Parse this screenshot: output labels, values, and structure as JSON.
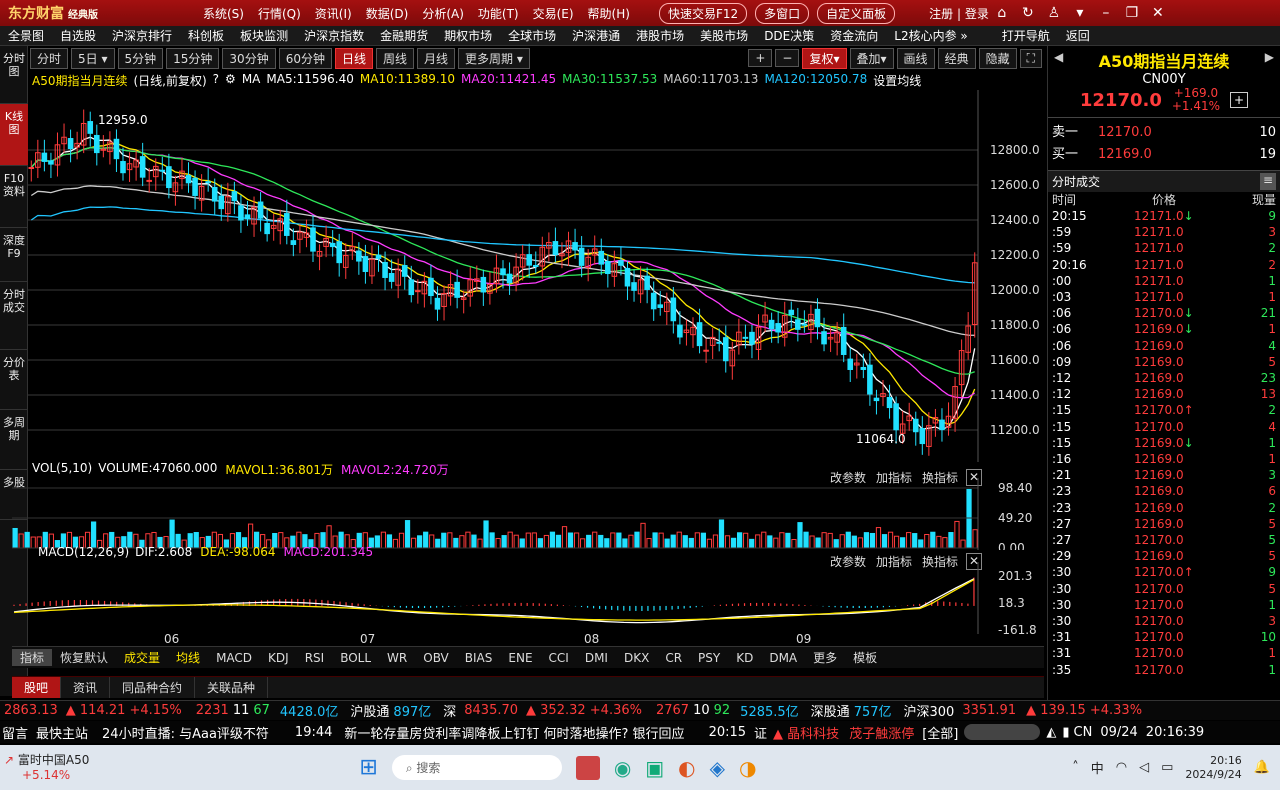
{
  "titlebar": {
    "app_name": "东方财富",
    "edition": "经典版",
    "menus": [
      "系统(S)",
      "行情(Q)",
      "资讯(I)",
      "数据(D)",
      "分析(A)",
      "功能(T)",
      "交易(E)",
      "帮助(H)"
    ],
    "quick_trade": "快速交易F12",
    "multi_window": "多窗口",
    "custom_panel": "自定义面板",
    "register_login": "注册 | 登录"
  },
  "navbar": {
    "items": [
      "全景图",
      "自选股",
      "沪深京排行",
      "科创板",
      "板块监测",
      "沪深京指数",
      "金融期货",
      "期权市场",
      "全球市场",
      "沪深港通",
      "港股市场",
      "美股市场",
      "DDE决策",
      "资金流向",
      "L2核心内参 »",
      "打开导航",
      "返回"
    ]
  },
  "left_tabs": [
    "分时图",
    "K线图",
    "F10资料",
    "深度F9",
    "分时成交",
    "分价表",
    "多周期",
    "多股"
  ],
  "period_bar": {
    "buttons": [
      "分时",
      "5日",
      "5分钟",
      "15分钟",
      "30分钟",
      "60分钟",
      "日线",
      "周线",
      "月线",
      "更多周期"
    ],
    "active": "日线",
    "right_buttons": [
      "复权",
      "叠加",
      "画线",
      "经典",
      "隐藏"
    ]
  },
  "ma_line": {
    "name": "A50期指当月连续",
    "mode": "(日线,前复权)",
    "ma_label": "MA",
    "ma5": "MA5:11596.40",
    "ma10": "MA10:11389.10",
    "ma20": "MA20:11421.45",
    "ma30": "MA30:11537.53",
    "ma60": "MA60:11703.13",
    "ma120": "MA120:12050.78",
    "set_ma": "设置均线"
  },
  "price_chart": {
    "y_ticks": [
      "12800.0",
      "12600.0",
      "12400.0",
      "12200.0",
      "12000.0",
      "11800.0",
      "11600.0",
      "11400.0",
      "11200.0"
    ],
    "high_label": "12959.0",
    "low_label": "11064.0",
    "x_labels": [
      "06",
      "07",
      "08",
      "09"
    ]
  },
  "volume_panel": {
    "title": "VOL(5,10)",
    "volume": "VOLUME:47060.000",
    "mavol1": "MAVOL1:36.801万",
    "mavol2": "MAVOL2:24.720万",
    "y_ticks": [
      "98.40",
      "49.20",
      "0.00"
    ],
    "actions": [
      "改参数",
      "加指标",
      "换指标"
    ]
  },
  "macd_panel": {
    "title": "MACD(12,26,9)",
    "dif": "DIF:2.608",
    "dea": "DEA:-98.064",
    "macd": "MACD:201.345",
    "y_ticks": [
      "201.3",
      "18.3",
      "-161.8"
    ],
    "actions": [
      "改参数",
      "加指标",
      "换指标"
    ]
  },
  "indicator_tabs": [
    "指标",
    "恢复默认",
    "成交量",
    "均线",
    "MACD",
    "KDJ",
    "RSI",
    "BOLL",
    "WR",
    "OBV",
    "BIAS",
    "ENE",
    "CCI",
    "DMI",
    "DKX",
    "CR",
    "PSY",
    "KD",
    "DMA",
    "更多",
    "模板"
  ],
  "bottom_tabs": [
    "股吧",
    "资讯",
    "同品种合约",
    "关联品种"
  ],
  "right_panel": {
    "name": "A50期指当月连续",
    "code": "CN00Y",
    "price": "12170.0",
    "change": "+169.0",
    "change_pct": "+1.41%",
    "sell1_label": "卖一",
    "sell1_price": "12170.0",
    "sell1_vol": "10",
    "buy1_label": "买一",
    "buy1_price": "12169.0",
    "buy1_vol": "19",
    "trades_title": "分时成交",
    "headers": [
      "时间",
      "价格",
      "现量"
    ],
    "trades": [
      {
        "t": "20:15",
        "p": "12171.0",
        "a": "↓",
        "v": "9"
      },
      {
        "t": ":59",
        "p": "12171.0",
        "a": "",
        "v": "3"
      },
      {
        "t": ":59",
        "p": "12171.0",
        "a": "",
        "v": "2"
      },
      {
        "t": "20:16",
        "p": "12171.0",
        "a": "",
        "v": "2"
      },
      {
        "t": ":00",
        "p": "12171.0",
        "a": "",
        "v": "1"
      },
      {
        "t": ":03",
        "p": "12171.0",
        "a": "",
        "v": "1"
      },
      {
        "t": ":06",
        "p": "12170.0",
        "a": "↓",
        "v": "21"
      },
      {
        "t": ":06",
        "p": "12169.0",
        "a": "↓",
        "v": "1"
      },
      {
        "t": ":06",
        "p": "12169.0",
        "a": "",
        "v": "4"
      },
      {
        "t": ":09",
        "p": "12169.0",
        "a": "",
        "v": "5"
      },
      {
        "t": ":12",
        "p": "12169.0",
        "a": "",
        "v": "23"
      },
      {
        "t": ":12",
        "p": "12169.0",
        "a": "",
        "v": "13"
      },
      {
        "t": ":15",
        "p": "12170.0",
        "a": "↑",
        "v": "2"
      },
      {
        "t": ":15",
        "p": "12170.0",
        "a": "",
        "v": "4"
      },
      {
        "t": ":15",
        "p": "12169.0",
        "a": "↓",
        "v": "1"
      },
      {
        "t": ":16",
        "p": "12169.0",
        "a": "",
        "v": "1"
      },
      {
        "t": ":21",
        "p": "12169.0",
        "a": "",
        "v": "3"
      },
      {
        "t": ":23",
        "p": "12169.0",
        "a": "",
        "v": "6"
      },
      {
        "t": ":23",
        "p": "12169.0",
        "a": "",
        "v": "2"
      },
      {
        "t": ":27",
        "p": "12169.0",
        "a": "",
        "v": "5"
      },
      {
        "t": ":27",
        "p": "12170.0",
        "a": "",
        "v": "5"
      },
      {
        "t": ":29",
        "p": "12169.0",
        "a": "",
        "v": "5"
      },
      {
        "t": ":30",
        "p": "12170.0",
        "a": "↑",
        "v": "9"
      },
      {
        "t": ":30",
        "p": "12170.0",
        "a": "",
        "v": "5"
      },
      {
        "t": ":30",
        "p": "12170.0",
        "a": "",
        "v": "1"
      },
      {
        "t": ":30",
        "p": "12170.0",
        "a": "",
        "v": "3"
      },
      {
        "t": ":31",
        "p": "12170.0",
        "a": "",
        "v": "10"
      },
      {
        "t": ":31",
        "p": "12170.0",
        "a": "",
        "v": "1"
      },
      {
        "t": ":35",
        "p": "12170.0",
        "a": "",
        "v": "1"
      }
    ]
  },
  "ticker": {
    "sh_index": "2863.13",
    "sh_change": "▲ 114.21 +4.15%",
    "sh_up": "2231",
    "sh_flat": "11",
    "sh_down": "67",
    "sh_amount": "4428.0亿",
    "hgt_label": "沪股通",
    "hgt_value": "897亿",
    "sz_label": "深",
    "sz_index": "8435.70",
    "sz_change": "▲ 352.32 +4.36%",
    "sz_up": "2767",
    "sz_flat": "10",
    "sz_down": "92",
    "sz_amount": "5285.5亿",
    "sgt_label": "深股通",
    "sgt_value": "757亿",
    "hs300_label": "沪深300",
    "hs300_value": "3351.91",
    "hs300_change": "▲ 139.15 +4.33%"
  },
  "newsbar": {
    "left1": "留言",
    "left2": "最快主站",
    "live": "24小时直播: 与Aaa评级不符",
    "time": "19:44",
    "headline": "新一轮存量房贷利率调降板上钉钉 何时落地操作? 银行回应",
    "time2": "20:15",
    "stock_prefix": "证",
    "stock1": "▲ 晶科科技",
    "stock2": "茂子触涨停",
    "all": "[全部]",
    "region": "CN",
    "date": "09/24",
    "clock": "20:16:39"
  },
  "taskbar": {
    "widget_name": "富时中国A50",
    "widget_change": "+5.14%",
    "search_placeholder": "搜索",
    "ime": "中",
    "time": "20:16",
    "date": "2024/9/24"
  },
  "colors": {
    "up": "#ff3c3c",
    "down": "#21c6ff",
    "ma5": "#ffffff",
    "ma10": "#ffe800",
    "ma20": "#ff3cff",
    "ma30": "#2ee85a",
    "ma60": "#cccccc",
    "ma120": "#21c6ff"
  }
}
